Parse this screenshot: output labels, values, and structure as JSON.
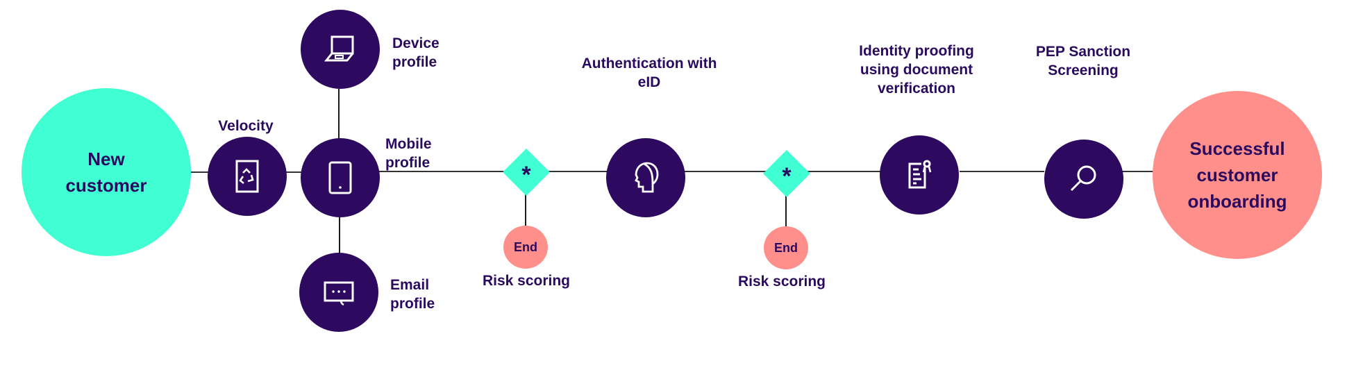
{
  "diagram": {
    "title": "",
    "colors": {
      "start": "#40ffd2",
      "step": "#2d0a5f",
      "decision": "#40ffd2",
      "end": "#ff8f8a",
      "text": "#2a0a5e",
      "connector": "#333333"
    },
    "start": {
      "label": "New\ncustomer"
    },
    "finish": {
      "label": "Successful\ncustomer\nonboarding"
    },
    "steps": [
      {
        "id": "velocity",
        "label": "Velocity",
        "icon": "recycle-document-icon"
      },
      {
        "id": "device-profile",
        "label": "Device\nprofile",
        "icon": "laptop-icon"
      },
      {
        "id": "mobile-profile",
        "label": "Mobile\nprofile",
        "icon": "mobile-phone-icon"
      },
      {
        "id": "email-profile",
        "label": "Email\nprofile",
        "icon": "message-icon"
      },
      {
        "id": "authentication",
        "label": "Authentication with\neID",
        "icon": "head-profile-icon"
      },
      {
        "id": "identity-proofing",
        "label": "Identity proofing\nusing document\nverification",
        "icon": "certificate-document-icon"
      },
      {
        "id": "pep-screening",
        "label": "PEP Sanction\nScreening",
        "icon": "magnifier-icon"
      }
    ],
    "decisions": [
      {
        "symbol": "*",
        "end_label": "End",
        "caption": "Risk scoring"
      },
      {
        "symbol": "*",
        "end_label": "End",
        "caption": "Risk scoring"
      }
    ]
  }
}
